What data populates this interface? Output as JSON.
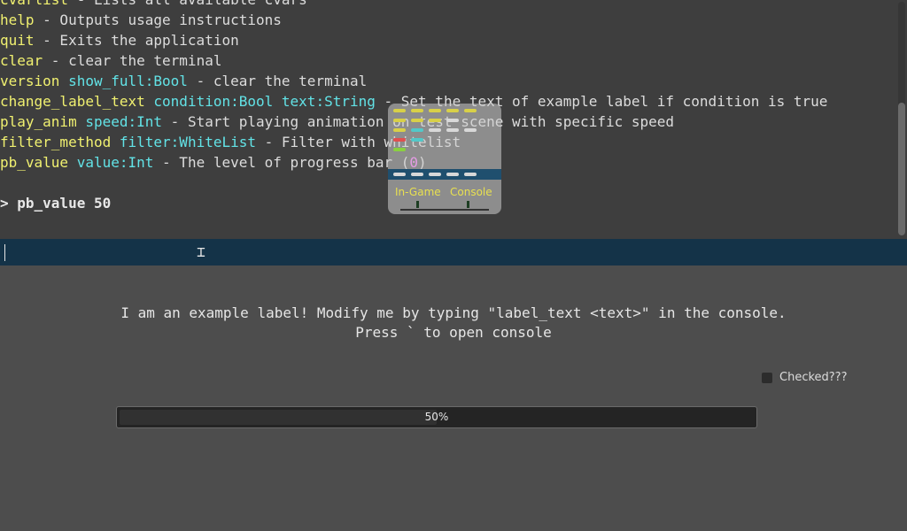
{
  "console": {
    "lines": [
      [
        {
          "t": "cvarlist",
          "c": "cmd"
        },
        {
          "t": " - Lists all available cvars",
          "c": "txt"
        }
      ],
      [
        {
          "t": "help",
          "c": "cmd"
        },
        {
          "t": " - Outputs usage instructions",
          "c": "txt"
        }
      ],
      [
        {
          "t": "quit",
          "c": "cmd"
        },
        {
          "t": " - Exits the application",
          "c": "txt"
        }
      ],
      [
        {
          "t": "clear",
          "c": "cmd"
        },
        {
          "t": " - clear the terminal",
          "c": "txt"
        }
      ],
      [
        {
          "t": "version",
          "c": "cmd"
        },
        {
          "t": " ",
          "c": "txt"
        },
        {
          "t": "show_full:Bool",
          "c": "arg"
        },
        {
          "t": " - clear the terminal",
          "c": "txt"
        }
      ],
      [
        {
          "t": "change_label_text",
          "c": "cmd"
        },
        {
          "t": " ",
          "c": "txt"
        },
        {
          "t": "condition:Bool",
          "c": "arg"
        },
        {
          "t": " ",
          "c": "txt"
        },
        {
          "t": "text:String",
          "c": "arg"
        },
        {
          "t": " - Set the text of example label if condition is true",
          "c": "txt"
        }
      ],
      [
        {
          "t": "play_anim",
          "c": "cmd"
        },
        {
          "t": " ",
          "c": "txt"
        },
        {
          "t": "speed:Int",
          "c": "arg"
        },
        {
          "t": " - Start playing animation on test scene with specific speed",
          "c": "txt"
        }
      ],
      [
        {
          "t": "filter_method",
          "c": "cmd"
        },
        {
          "t": " ",
          "c": "txt"
        },
        {
          "t": "filter:WhiteList",
          "c": "arg"
        },
        {
          "t": " - Filter with whitelist",
          "c": "txt"
        }
      ],
      [
        {
          "t": "pb_value",
          "c": "cmd"
        },
        {
          "t": " ",
          "c": "txt"
        },
        {
          "t": "value:Int",
          "c": "arg"
        },
        {
          "t": " - The level of progress bar (",
          "c": "txt"
        },
        {
          "t": "0",
          "c": "num"
        },
        {
          "t": ")",
          "c": "txt"
        }
      ],
      [],
      [
        {
          "t": "> pb_value 50",
          "c": "echo"
        }
      ]
    ],
    "input_value": ""
  },
  "app_icon": {
    "left_label": "In-Game",
    "right_label": "Console"
  },
  "scene": {
    "example_label_line1": "I am an example label! Modify me by typing \"label_text <text>\" in the console.",
    "example_label_line2": "Press ` to open console",
    "checkbox_label": "Checked???",
    "checkbox_checked": false,
    "progress_fraction": 0.5,
    "progress_text": "50%"
  },
  "colors": {
    "command": "#f0f070",
    "argument": "#62e2e6",
    "number": "#ff60ff",
    "input_bar": "#143348"
  }
}
